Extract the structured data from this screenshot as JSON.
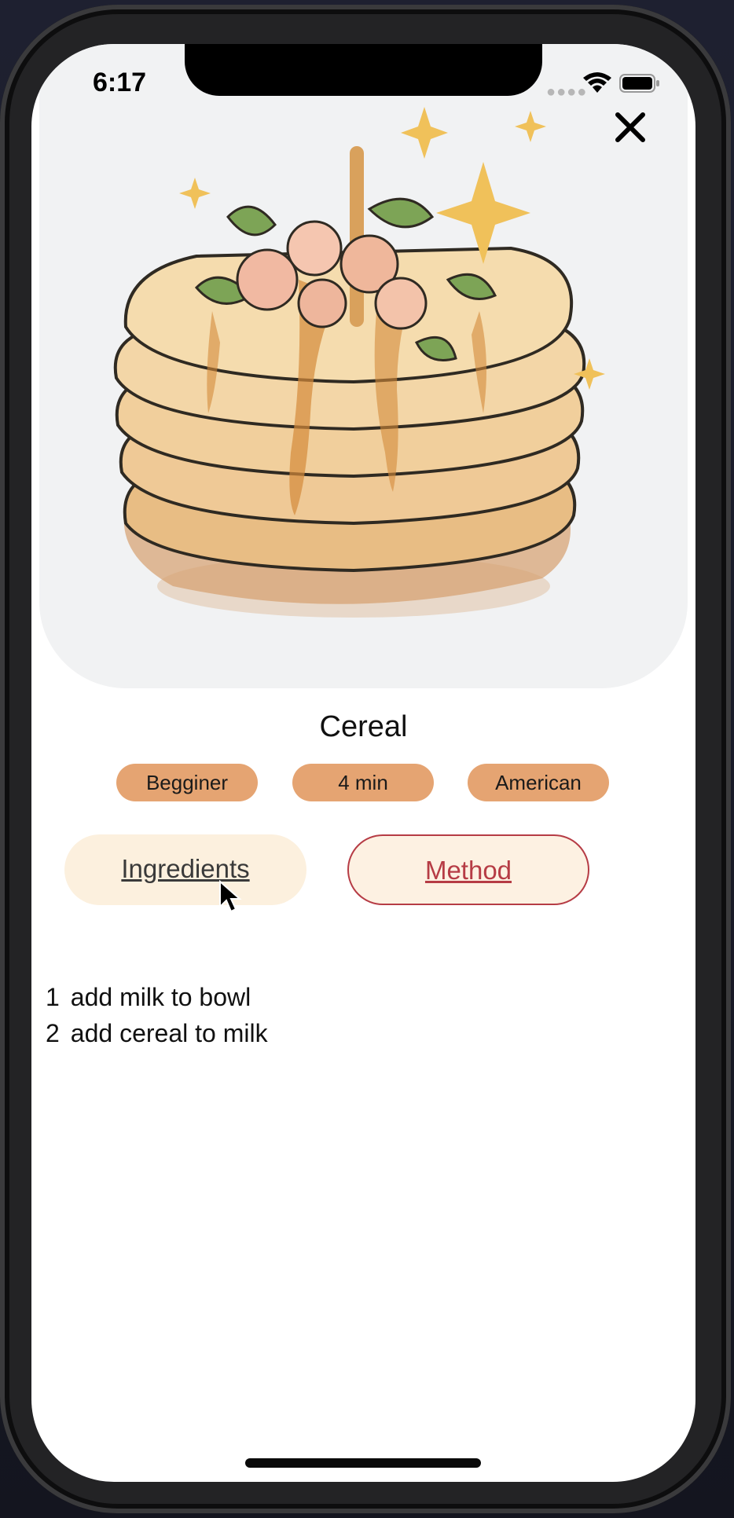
{
  "status_bar": {
    "time": "6:17"
  },
  "recipe": {
    "title": "Cereal",
    "tags": [
      "Begginer",
      "4 min",
      "American"
    ]
  },
  "tabs": {
    "ingredients_label": "Ingredients",
    "method_label": "Method"
  },
  "method_steps": [
    {
      "num": "1",
      "text": "add milk to bowl"
    },
    {
      "num": "2",
      "text": "add cereal to milk"
    }
  ],
  "colors": {
    "tag_bg": "#e5a472",
    "tab_inactive_bg": "#fcf0de",
    "tab_active_border": "#b63c45",
    "hero_bg": "#f1f2f3"
  },
  "icons": [
    "close-icon",
    "wifi-icon",
    "battery-icon",
    "cursor-icon",
    "pancake-image"
  ]
}
